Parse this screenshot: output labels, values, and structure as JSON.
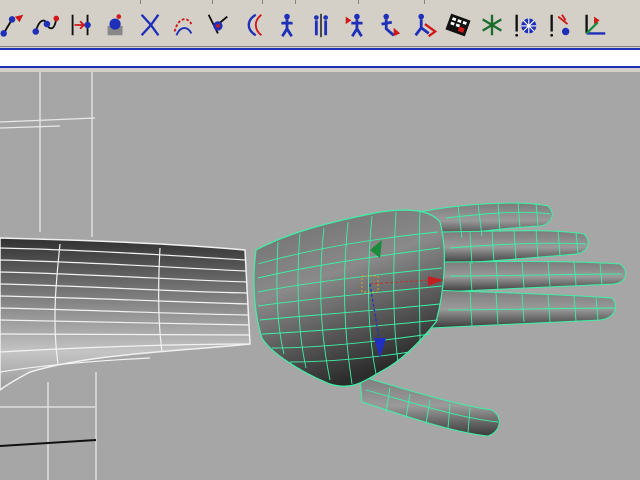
{
  "app": {
    "accent": "#1e2fb8",
    "viewport_bg": "#a6a6a6",
    "wire_color": "#3df0a8"
  },
  "shelf": {
    "tools": [
      {
        "icon": "ik-handle-tool-icon"
      },
      {
        "icon": "ik-spline-handle-tool-icon"
      },
      {
        "icon": "joint-tool-icon"
      },
      {
        "icon": "bind-skin-icon"
      },
      {
        "icon": "curve-tool-icon"
      },
      {
        "icon": "edit-curve-icon"
      },
      {
        "icon": "cluster-deformer-icon"
      },
      {
        "icon": "wire-deformer-icon"
      },
      {
        "icon": "character-figure-icon"
      },
      {
        "icon": "mirror-joint-icon"
      },
      {
        "icon": "character-pose-icon"
      },
      {
        "icon": "skin-weight-icon"
      },
      {
        "icon": "character-paint-icon"
      },
      {
        "icon": "keyframe-grid-icon"
      },
      {
        "icon": "star-locator-icon"
      },
      {
        "icon": "rigid-body-icon"
      },
      {
        "icon": "field-emitter-icon"
      },
      {
        "icon": "axis-locator-icon"
      }
    ]
  },
  "command_line": {
    "value": ""
  },
  "viewport": {
    "objects": [
      "hand-mesh",
      "arm-mesh",
      "transform-manipulator"
    ]
  }
}
